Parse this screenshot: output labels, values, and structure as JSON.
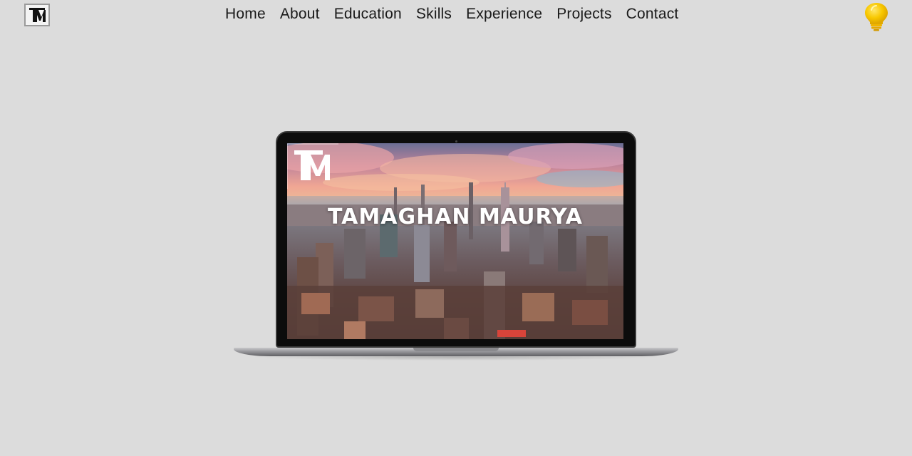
{
  "header": {
    "logo_icon": "tm-monogram-icon",
    "nav": [
      {
        "label": "Home"
      },
      {
        "label": "About"
      },
      {
        "label": "Education"
      },
      {
        "label": "Skills"
      },
      {
        "label": "Experience"
      },
      {
        "label": "Projects"
      },
      {
        "label": "Contact"
      }
    ],
    "theme_toggle_icon": "lightbulb-icon"
  },
  "hero": {
    "name": "TAMAGHAN MAURYA",
    "mark_icon": "tm-monogram-icon",
    "device": "laptop",
    "background_image": "city-skyline-aerial"
  },
  "colors": {
    "page_background": "#dcdcdc",
    "nav_text": "#1a1a1a",
    "bulb": "#f5c400",
    "hero_text": "#ffffff"
  }
}
